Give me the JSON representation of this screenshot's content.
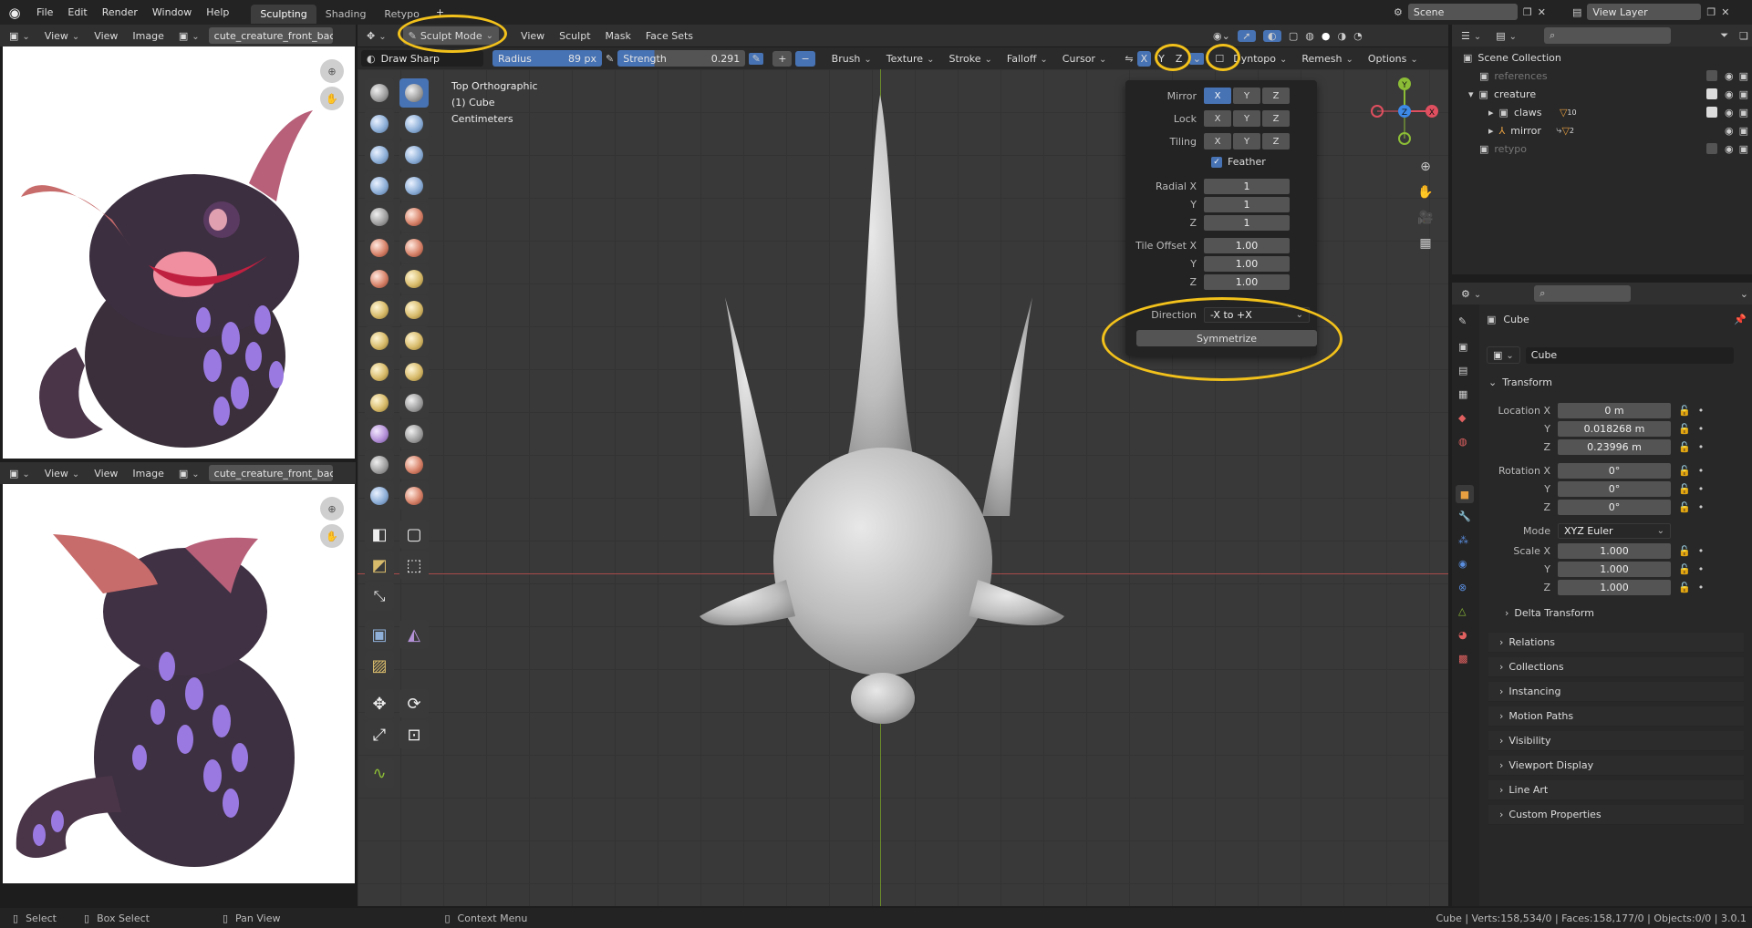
{
  "topbar": {
    "menus": [
      "File",
      "Edit",
      "Render",
      "Window",
      "Help"
    ],
    "workspaces": [
      "Sculpting",
      "Shading",
      "Retypo"
    ],
    "add_workspace": "+",
    "scene": "Scene",
    "view_layer": "View Layer"
  },
  "image_editor": {
    "view_menus": [
      "View",
      "View",
      "Image"
    ],
    "image_name": "cute_creature_front_back."
  },
  "viewport_header": {
    "mode": "Sculpt Mode",
    "menus": [
      "View",
      "Sculpt",
      "Mask",
      "Face Sets"
    ]
  },
  "tool_settings": {
    "brush_name": "Draw Sharp",
    "radius_label": "Radius",
    "radius_value": "89 px",
    "strength_label": "Strength",
    "strength_value": "0.291",
    "plus": "+",
    "minus": "−",
    "menus": [
      "Brush",
      "Texture",
      "Stroke",
      "Falloff",
      "Cursor"
    ],
    "axis_x": "X",
    "axis_y": "Y",
    "axis_z": "Z",
    "dyntopo": "Dyntopo",
    "remesh": "Remesh",
    "options": "Options"
  },
  "overlay_text": {
    "line1": "Top Orthographic",
    "line2": "(1) Cube",
    "line3": "Centimeters"
  },
  "symmetry_popup": {
    "mirror_label": "Mirror",
    "lock_label": "Lock",
    "tiling_label": "Tiling",
    "x": "X",
    "y": "Y",
    "z": "Z",
    "feather_label": "Feather",
    "radial_x_label": "Radial X",
    "radial_y_label": "Y",
    "radial_z_label": "Z",
    "radial_x": "1",
    "radial_y": "1",
    "radial_z": "1",
    "tile_offset_x_label": "Tile Offset X",
    "tile_offset_y_label": "Y",
    "tile_offset_z_label": "Z",
    "tile_offset_x": "1.00",
    "tile_offset_y": "1.00",
    "tile_offset_z": "1.00",
    "direction_label": "Direction",
    "direction_value": "-X to +X",
    "symmetrize_button": "Symmetrize"
  },
  "gizmo": {
    "x": "X",
    "y": "Y",
    "z": "Z"
  },
  "outliner": {
    "root": "Scene Collection",
    "items": [
      "references",
      "creature",
      "claws",
      "mirror",
      "retypo"
    ],
    "claws_count": "10",
    "mirror_count": "2"
  },
  "properties": {
    "object_name": "Cube",
    "data_name": "Cube",
    "transform_title": "Transform",
    "location_x_label": "Location X",
    "location_x": "0 m",
    "location_y_label": "Y",
    "location_y": "0.018268 m",
    "location_z_label": "Z",
    "location_z": "0.23996 m",
    "rotation_x_label": "Rotation X",
    "rotation_x": "0°",
    "rotation_y_label": "Y",
    "rotation_y": "0°",
    "rotation_z_label": "Z",
    "rotation_z": "0°",
    "mode_label": "Mode",
    "mode_value": "XYZ Euler",
    "scale_x_label": "Scale X",
    "scale_x": "1.000",
    "scale_y_label": "Y",
    "scale_y": "1.000",
    "scale_z_label": "Z",
    "scale_z": "1.000",
    "delta_transform": "Delta Transform",
    "sections": [
      "Relations",
      "Collections",
      "Instancing",
      "Motion Paths",
      "Visibility",
      "Viewport Display",
      "Line Art",
      "Custom Properties"
    ]
  },
  "statusbar": {
    "select": "Select",
    "box_select": "Box Select",
    "pan_view": "Pan View",
    "context_menu": "Context Menu",
    "stats": "Cube | Verts:158,534/0 | Faces:158,177/0 | Objects:0/0 | 3.0.1"
  },
  "colors": {
    "accent": "#4772b3",
    "annotation": "#f2c11b",
    "x_axis": "#e04f5f",
    "y_axis": "#8cbd36",
    "z_axis": "#3d89e6"
  }
}
